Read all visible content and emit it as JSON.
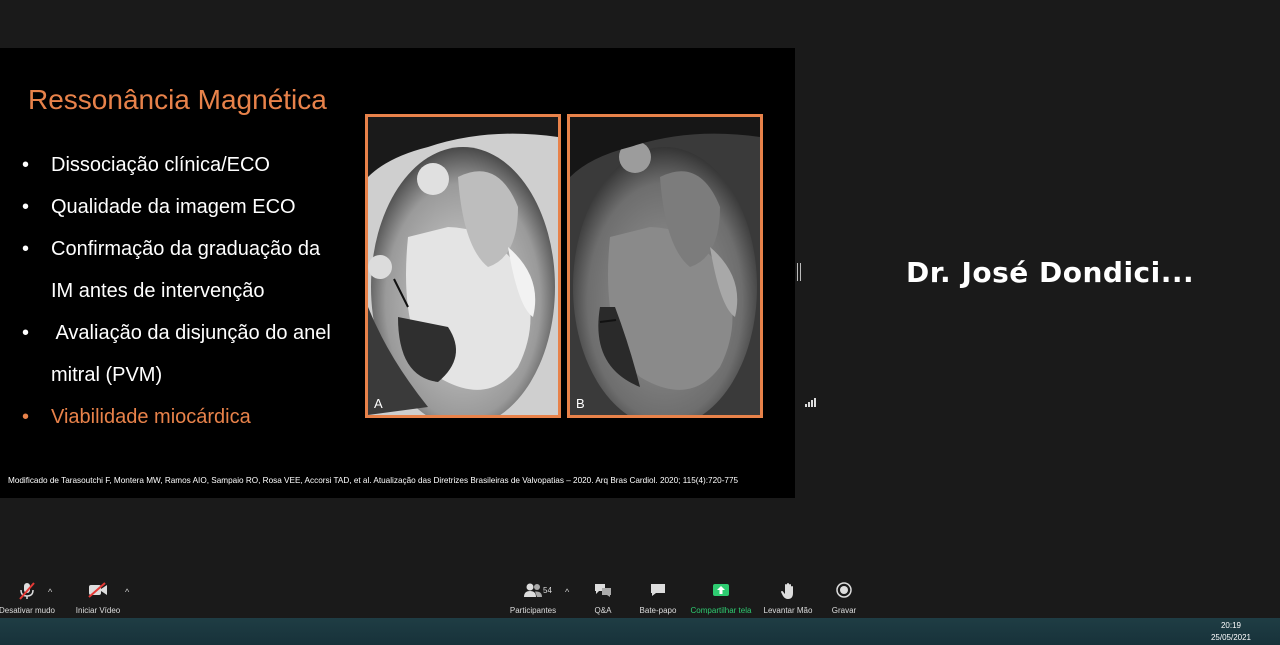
{
  "slide": {
    "title": "Ressonância Magnética",
    "bullets": [
      {
        "line1": "Dissociação clínica/ECO",
        "line2": ""
      },
      {
        "line1": "Qualidade da imagem ECO",
        "line2": ""
      },
      {
        "line1": "Confirmação da graduação da",
        "line2": "IM antes de intervenção"
      },
      {
        "line1": " Avaliação da disjunção do anel",
        "line2": "mitral (PVM)"
      },
      {
        "line1": "Viabilidade miocárdica",
        "line2": ""
      }
    ],
    "bullet_symbol": "•",
    "image_labels": [
      "A",
      "B"
    ],
    "citation": "Modificado de Tarasoutchi F, Montera MW, Ramos AIO, Sampaio RO, Rosa VEE, Accorsi TAD, et al. Atualização das Diretrizes Brasileiras de Valvopatias – 2020. Arq Bras Cardiol. 2020; 115(4):720-775",
    "colors": {
      "accent": "#e8824a",
      "background": "#000000"
    }
  },
  "participant": {
    "name": "Dr. José Dondici..."
  },
  "toolbar": {
    "mute_label": "Desativar mudo",
    "video_label": "Iniciar Vídeo",
    "participants_label": "Participantes",
    "participants_count": "54",
    "qa_label": "Q&A",
    "chat_label": "Bate-papo",
    "share_label": "Compartilhar tela",
    "raise_hand_label": "Levantar Mão",
    "record_label": "Gravar",
    "caret": "^",
    "colors": {
      "share": "#2ecc71",
      "mute_slash": "#e53935"
    }
  },
  "taskbar": {
    "time": "20:19",
    "date": "25/05/2021"
  }
}
